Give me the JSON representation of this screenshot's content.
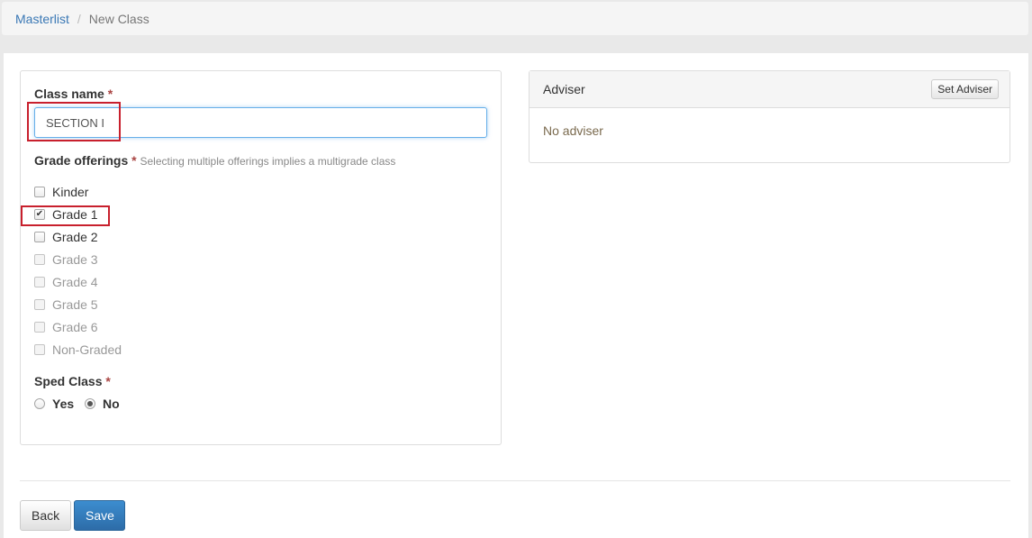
{
  "breadcrumb": {
    "root": "Masterlist",
    "separator": "/",
    "current": "New Class"
  },
  "form": {
    "class_name_label": "Class name",
    "required_mark": "*",
    "class_name_value": "SECTION I",
    "grade_offerings_label": "Grade offerings",
    "grade_offerings_hint": "Selecting multiple offerings implies a multigrade class",
    "grade_options": [
      {
        "label": "Kinder",
        "checked": false,
        "disabled": false
      },
      {
        "label": "Grade 1",
        "checked": true,
        "disabled": false
      },
      {
        "label": "Grade 2",
        "checked": false,
        "disabled": false
      },
      {
        "label": "Grade 3",
        "checked": false,
        "disabled": true
      },
      {
        "label": "Grade 4",
        "checked": false,
        "disabled": true
      },
      {
        "label": "Grade 5",
        "checked": false,
        "disabled": true
      },
      {
        "label": "Grade 6",
        "checked": false,
        "disabled": true
      },
      {
        "label": "Non-Graded",
        "checked": false,
        "disabled": true
      }
    ],
    "sped_label": "Sped Class",
    "sped_options": [
      {
        "label": "Yes",
        "selected": false
      },
      {
        "label": "No",
        "selected": true
      }
    ]
  },
  "adviser": {
    "title": "Adviser",
    "set_button": "Set Adviser",
    "empty_text": "No adviser"
  },
  "actions": {
    "back_label": "Back",
    "save_label": "Save"
  },
  "colors": {
    "link": "#3a78b5",
    "primary": "#337ab7",
    "required": "#a94442",
    "annotation": "#c8202d"
  }
}
